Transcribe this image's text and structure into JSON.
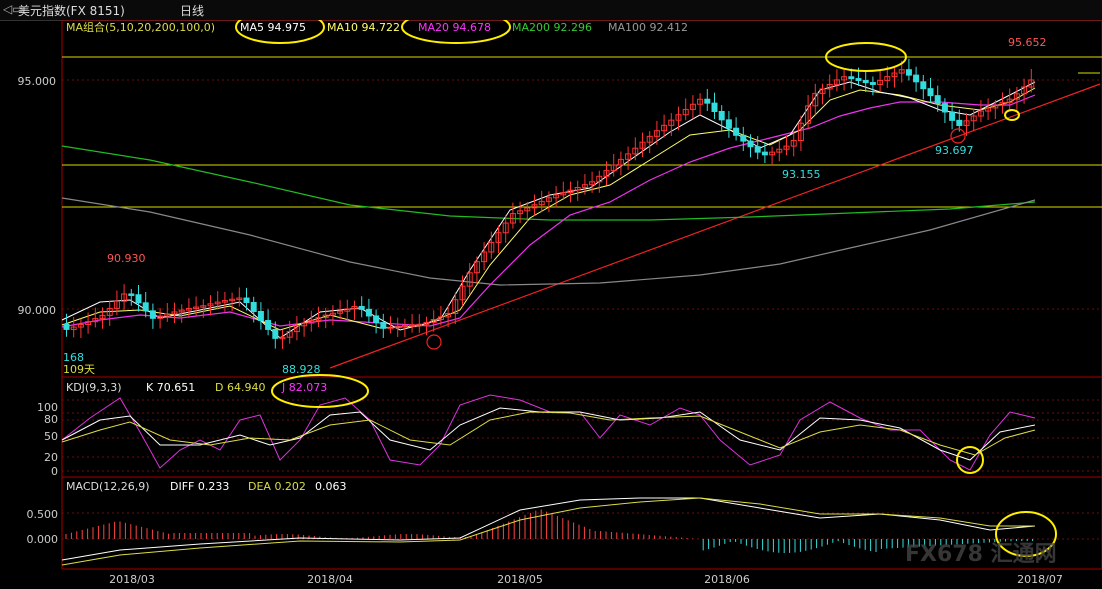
{
  "window": {
    "title": "美元指数(FX 8151)",
    "period": "日线"
  },
  "main_panel": {
    "ma_group_label": "MA组合(5,10,20,200,100,0)",
    "ma_values": [
      {
        "label": "MA5 94.975",
        "color": "#ffffff"
      },
      {
        "label": "MA10 94.722",
        "color": "#ffff66"
      },
      {
        "label": "MA20 94.678",
        "color": "#ff33ff"
      },
      {
        "label": "MA200 92.296",
        "color": "#33cc33"
      },
      {
        "label": "MA100 92.412",
        "color": "#999999"
      }
    ],
    "y_ticks": [
      "95.000",
      "90.000"
    ],
    "annotations": {
      "high_label": "95.652",
      "left_high": "90.930",
      "left_low": "88.928",
      "mid_low": "93.155",
      "right_low": "93.697",
      "edge_a": "168",
      "edge_b": "109天"
    }
  },
  "kdj_panel": {
    "header": "KDJ(9,3,3)",
    "k": "K 70.651",
    "d": "D 64.940",
    "j": "J 82.073",
    "y_ticks": [
      "100",
      "80",
      "50",
      "20",
      "0"
    ]
  },
  "macd_panel": {
    "header": "MACD(12,26,9)",
    "diff": "DIFF 0.233",
    "dea": "DEA 0.202",
    "macd": "0.063",
    "y_ticks": [
      "0.500",
      "0.000"
    ]
  },
  "x_axis": {
    "labels": [
      "2018/03",
      "2018/04",
      "2018/05",
      "2018/06",
      "2018/07"
    ]
  },
  "watermark": "FX678 汇通网",
  "chart_data": [
    {
      "type": "line",
      "title": "美元指数(FX 8151) 日线",
      "x": [
        "2018/03",
        "2018/04",
        "2018/05",
        "2018/06",
        "2018/07"
      ],
      "ylim": [
        88.5,
        96.0
      ],
      "series": [
        {
          "name": "MA5",
          "last": 94.975
        },
        {
          "name": "MA10",
          "last": 94.722
        },
        {
          "name": "MA20",
          "last": 94.678
        },
        {
          "name": "MA200",
          "last": 92.296
        },
        {
          "name": "MA100",
          "last": 92.412
        }
      ],
      "points": {
        "high": 95.652,
        "left_high": 90.93,
        "left_low": 88.928,
        "mid_low": 93.155,
        "right_low": 93.697
      }
    },
    {
      "type": "line",
      "title": "KDJ(9,3,3)",
      "series": [
        {
          "name": "K",
          "last": 70.651
        },
        {
          "name": "D",
          "last": 64.94
        },
        {
          "name": "J",
          "last": 82.073
        }
      ],
      "ylim": [
        0,
        100
      ]
    },
    {
      "type": "bar",
      "title": "MACD(12,26,9)",
      "series": [
        {
          "name": "DIFF",
          "last": 0.233
        },
        {
          "name": "DEA",
          "last": 0.202
        },
        {
          "name": "MACD",
          "last": 0.063
        }
      ]
    }
  ]
}
